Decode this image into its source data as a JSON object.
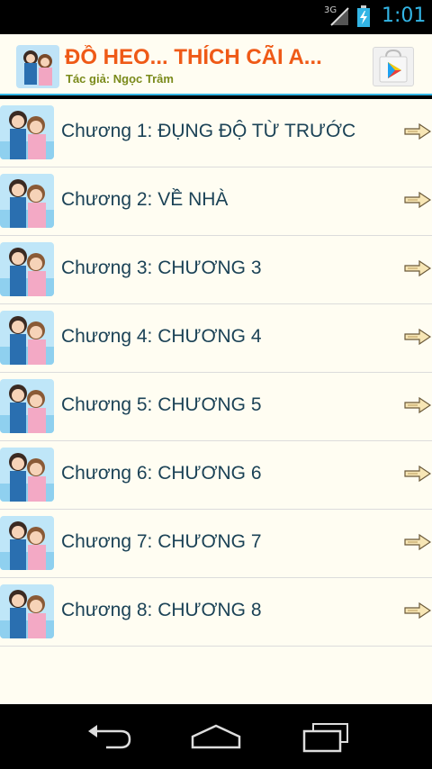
{
  "status_bar": {
    "network": "3G",
    "time": "1:01",
    "icons": [
      "signal-icon",
      "battery-charging-icon"
    ]
  },
  "header": {
    "title": "ĐỒ HEO... THÍCH CÃI A...",
    "author": "Tác giả: Ngọc Trâm",
    "cover_icon": "book-cover-image",
    "store_icon": "play-store-icon"
  },
  "chapters": [
    {
      "label": "Chương 1: ĐỤNG ĐỘ TỪ TRƯỚC"
    },
    {
      "label": "Chương 2: VỀ NHÀ"
    },
    {
      "label": "Chương 3: CHƯƠNG 3"
    },
    {
      "label": "Chương 4: CHƯƠNG 4"
    },
    {
      "label": "Chương 5: CHƯƠNG 5"
    },
    {
      "label": "Chương 6: CHƯƠNG 6"
    },
    {
      "label": "Chương 7: CHƯƠNG 7"
    },
    {
      "label": "Chương 8: CHƯƠNG 8"
    }
  ],
  "navbar": {
    "icons": [
      "back-icon",
      "home-icon",
      "recent-apps-icon"
    ]
  },
  "colors": {
    "accent": "#33b5e5",
    "title": "#ef5a17",
    "author": "#7a8a1a",
    "chapter_text": "#1b4256",
    "background": "#fffdf2"
  }
}
